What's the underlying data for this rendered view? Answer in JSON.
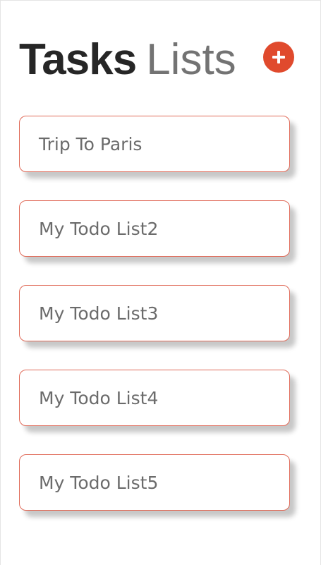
{
  "header": {
    "title_bold": "Tasks",
    "title_light": "Lists",
    "add_icon": "plus-circle-icon"
  },
  "colors": {
    "accent": "#e04a2d",
    "card_border": "#e06a58",
    "title_dark": "#262626",
    "title_grey": "#737373",
    "card_text": "#6b6b6b"
  },
  "lists": [
    {
      "label": "Trip To Paris"
    },
    {
      "label": "My Todo List2"
    },
    {
      "label": "My Todo List3"
    },
    {
      "label": "My Todo List4"
    },
    {
      "label": "My Todo List5"
    }
  ]
}
